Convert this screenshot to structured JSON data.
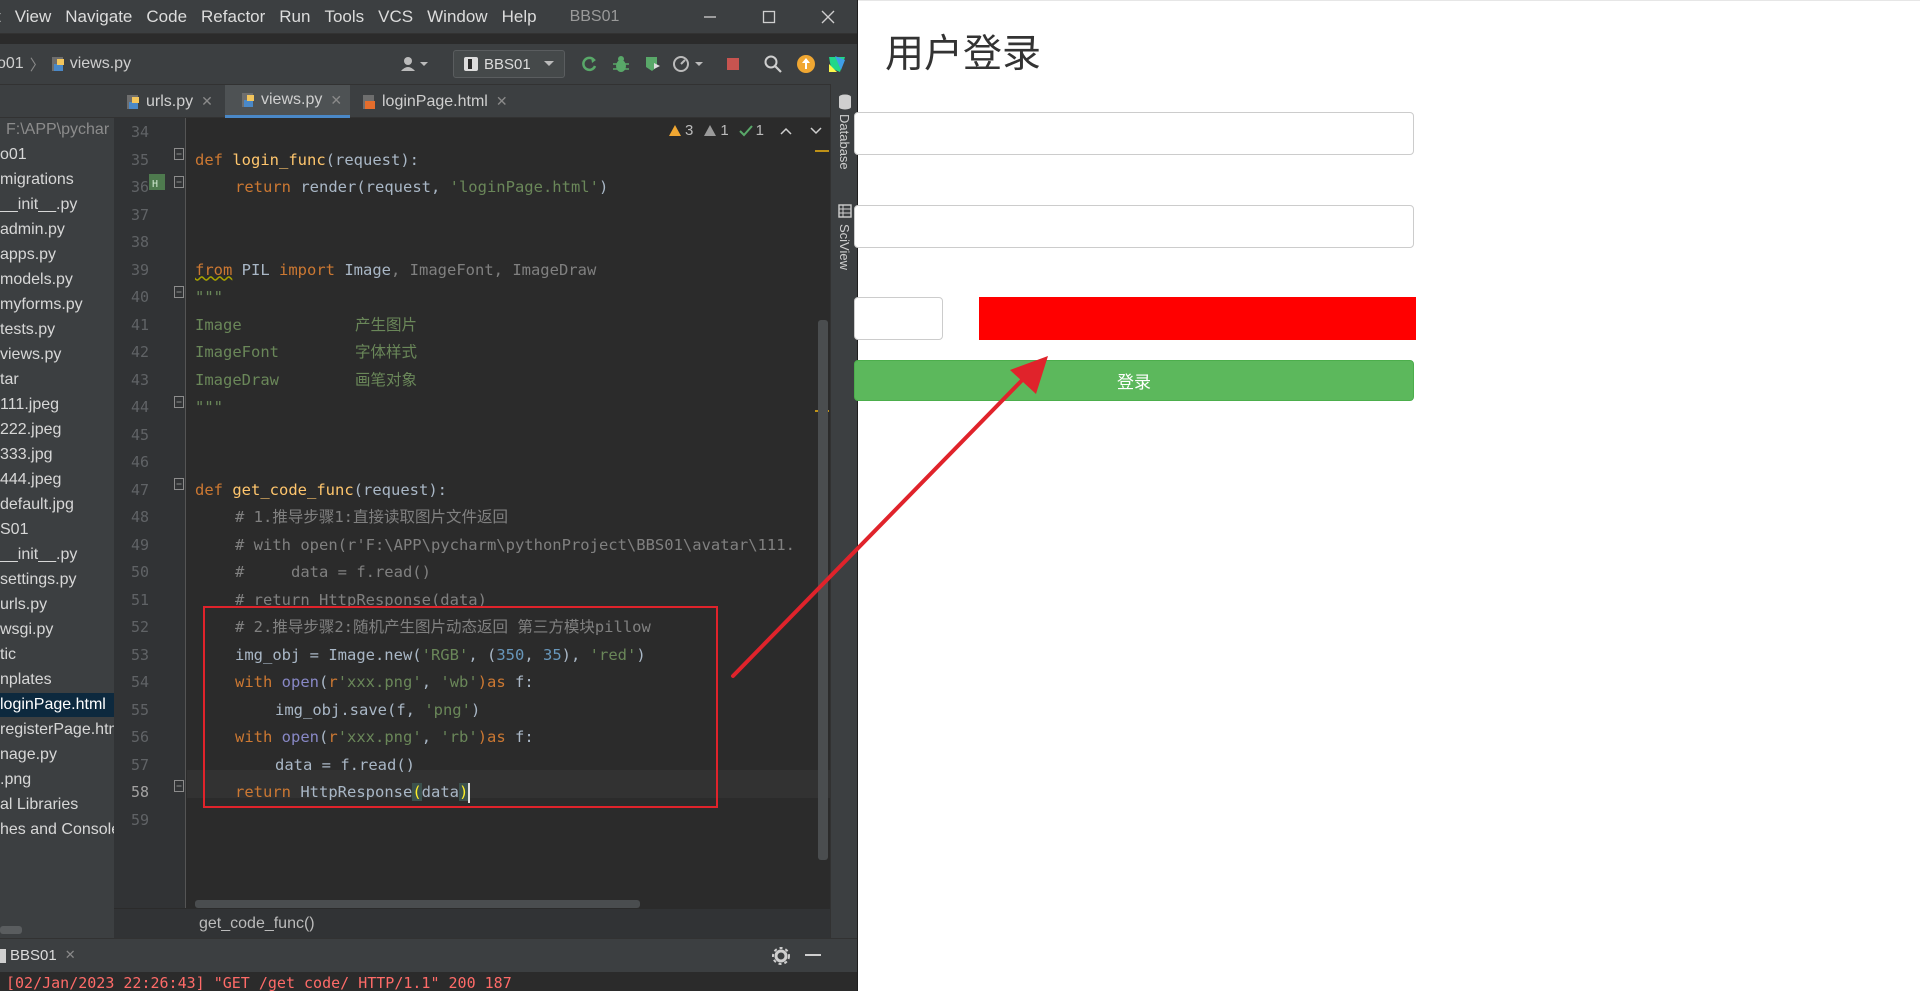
{
  "ide": {
    "menu": [
      "t",
      "View",
      "Navigate",
      "Code",
      "Refactor",
      "Run",
      "Tools",
      "VCS",
      "Window",
      "Help"
    ],
    "window_title": "BBS01",
    "breadcrumb": [
      "o01",
      "views.py"
    ],
    "run_config": "BBS01",
    "tabs": [
      {
        "label": "urls.py"
      },
      {
        "label": "views.py"
      },
      {
        "label": "loginPage.html"
      }
    ],
    "project_items": [
      "F:\\APP\\pychar",
      "o01",
      "migrations",
      "__init__.py",
      "admin.py",
      "apps.py",
      "models.py",
      "myforms.py",
      "tests.py",
      "views.py",
      "tar",
      "111.jpeg",
      "222.jpeg",
      "333.jpg",
      "444.jpeg",
      "default.jpg",
      "S01",
      "__init__.py",
      "settings.py",
      "urls.py",
      "wsgi.py",
      "tic",
      "nplates",
      "loginPage.html",
      "registerPage.htm",
      "nage.py",
      ".png",
      "al Libraries",
      "hes and Console"
    ],
    "line_numbers": [
      "34",
      "35",
      "36",
      "37",
      "38",
      "39",
      "40",
      "41",
      "42",
      "43",
      "44",
      "45",
      "46",
      "47",
      "48",
      "49",
      "50",
      "51",
      "52",
      "53",
      "54",
      "55",
      "56",
      "57",
      "58",
      "59"
    ],
    "inspections": {
      "warnings": "3",
      "weak_warnings": "1",
      "typos": "1"
    },
    "side_labels": {
      "database": "Database",
      "sciview": "SciView"
    },
    "footer_breadcrumb": "get_code_func()",
    "run_tab": "BBS01",
    "run_output": "[02/Jan/2023 22:26:43] \"GET /get_code/ HTTP/1.1\" 200 187",
    "code": {
      "l35_def": "def",
      "l35_name": "login_func",
      "l35_rest": "(request):",
      "l36_return": "return",
      "l36_call": " render(request, ",
      "l36_str": "'loginPage.html'",
      "l36_end": ")",
      "l39_from": "from",
      "l39_mod": " PIL ",
      "l39_import": "import",
      "l39_names": " Image",
      "l39_rest": ", ImageFont, ImageDraw",
      "l40": "\"\"\"",
      "l41_a": "Image",
      "l41_b": "产生图片",
      "l42_a": "ImageFont",
      "l42_b": "字体样式",
      "l43_a": "ImageDraw",
      "l43_b": "画笔对象",
      "l44": "\"\"\"",
      "l47_def": "def",
      "l47_name": "get_code_func",
      "l47_rest": "(request):",
      "l48": "# 1.推导步骤1:直接读取图片文件返回",
      "l49": "# with open(r'F:\\APP\\pycharm\\pythonProject\\BBS01\\avatar\\111.",
      "l50": "#     data = f.read()",
      "l51": "# return HttpResponse(data)",
      "l52": "# 2.推导步骤2:随机产生图片动态返回 第三方模块pillow",
      "l53_a": "img_obj = Image.new(",
      "l53_s1": "'RGB'",
      "l53_b": ", (",
      "l53_n1": "350",
      "l53_c": ", ",
      "l53_n2": "35",
      "l53_d": "), ",
      "l53_s2": "'red'",
      "l53_e": ")",
      "l54_with": "with",
      "l54_open": " open",
      "l54_p": "(",
      "l54_r": "r",
      "l54_s1": "'xxx.png'",
      "l54_c": ", ",
      "l54_s2": "'wb'",
      "l54_as": ")as",
      "l54_f": " f:",
      "l55_a": "img_obj.save(f, ",
      "l55_s": "'png'",
      "l55_e": ")",
      "l56_with": "with",
      "l56_open": " open",
      "l56_p": "(",
      "l56_r": "r",
      "l56_s1": "'xxx.png'",
      "l56_c": ", ",
      "l56_s2": "'rb'",
      "l56_as": ")as",
      "l56_f": " f:",
      "l57": "data = f.read()",
      "l58_return": "return",
      "l58_call": " HttpResponse",
      "l58_open": "(",
      "l58_arg": "data",
      "l58_close": ")"
    }
  },
  "page": {
    "title": "用户登录",
    "login_button": "登录",
    "captcha_color": "#ff0000",
    "button_color": "#5cb85c"
  },
  "annotation": {
    "box_color": "#e0232b",
    "arrow_color": "#e0232b"
  }
}
